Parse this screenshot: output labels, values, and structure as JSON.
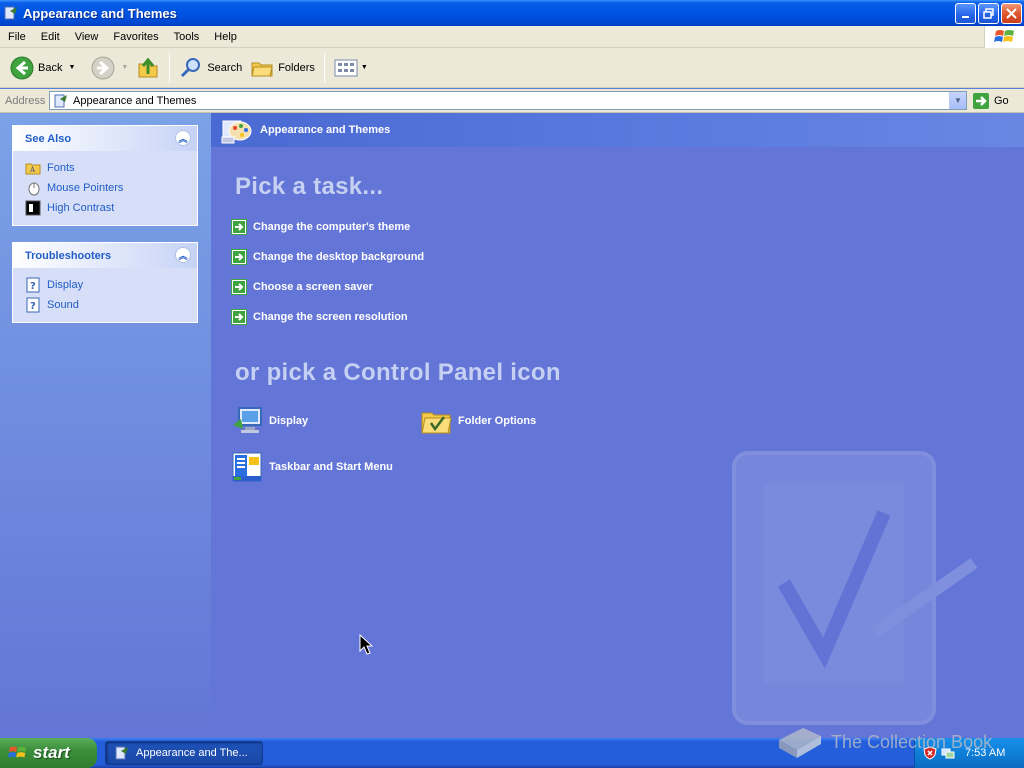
{
  "window": {
    "title": "Appearance and Themes"
  },
  "menu": [
    "File",
    "Edit",
    "View",
    "Favorites",
    "Tools",
    "Help"
  ],
  "toolbar": {
    "back_label": "Back",
    "search_label": "Search",
    "folders_label": "Folders"
  },
  "address": {
    "label": "Address",
    "value": "Appearance and Themes",
    "go_label": "Go"
  },
  "see_also": {
    "title": "See Also",
    "items": [
      "Fonts",
      "Mouse Pointers",
      "High Contrast"
    ]
  },
  "troubleshooters": {
    "title": "Troubleshooters",
    "items": [
      "Display",
      "Sound"
    ]
  },
  "main": {
    "header": "Appearance and Themes",
    "pick_task": "Pick a task...",
    "tasks": [
      "Change the computer's theme",
      "Change the desktop background",
      "Choose a screen saver",
      "Change the screen resolution"
    ],
    "pick_icon": "or pick a Control Panel icon",
    "icons": [
      "Display",
      "Folder Options",
      "Taskbar and Start Menu"
    ]
  },
  "taskbar": {
    "start_label": "start",
    "task_label": "Appearance and The...",
    "clock": "7:53 AM"
  },
  "brand": "The Collection Book",
  "colors": {
    "titlebar": "#0054e3",
    "link": "#215dc6",
    "main_bg": "#6375d6",
    "start": "#3c8f3c"
  }
}
